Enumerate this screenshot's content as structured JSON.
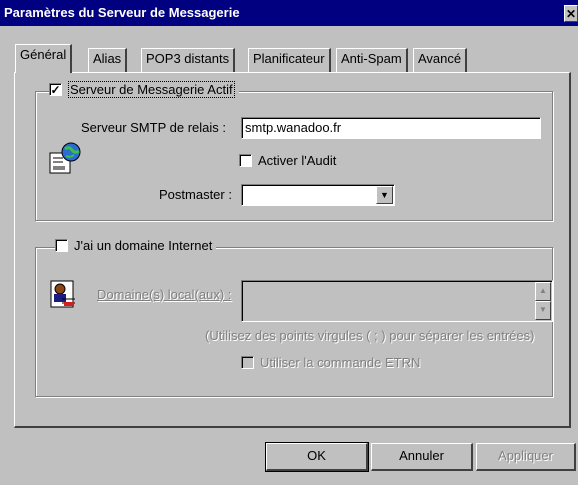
{
  "window": {
    "title": "Paramètres du Serveur de Messagerie",
    "close_glyph": "✕"
  },
  "tabs": [
    {
      "label": "Général",
      "active": true
    },
    {
      "label": "Alias"
    },
    {
      "label": "POP3 distants"
    },
    {
      "label": "Planificateur"
    },
    {
      "label": "Anti-Spam"
    },
    {
      "label": "Avancé"
    }
  ],
  "mail_server": {
    "active_label": "Serveur de Messagerie Actif",
    "active_checked": true,
    "smtp_relay_label": "Serveur SMTP de relais :",
    "smtp_relay_value": "smtp.wanadoo.fr",
    "audit_label": "Activer l'Audit",
    "audit_checked": false,
    "postmaster_label": "Postmaster :",
    "postmaster_value": ""
  },
  "internet_domain": {
    "label": "J'ai un domaine Internet",
    "checked": false,
    "local_domains_label": "Domaine(s) local(aux) :",
    "hint": "(Utilisez des points virgules ( ; ) pour séparer les entrées)",
    "etrn_label": "Utiliser la commande ETRN",
    "etrn_checked": false
  },
  "buttons": {
    "ok": "OK",
    "cancel": "Annuler",
    "apply": "Appliquer"
  },
  "colors": {
    "titlebar": "#000080",
    "face": "#c0c0c0",
    "disabled_text": "#808080"
  },
  "icons": [
    "mail-server-icon",
    "domain-user-icon"
  ]
}
